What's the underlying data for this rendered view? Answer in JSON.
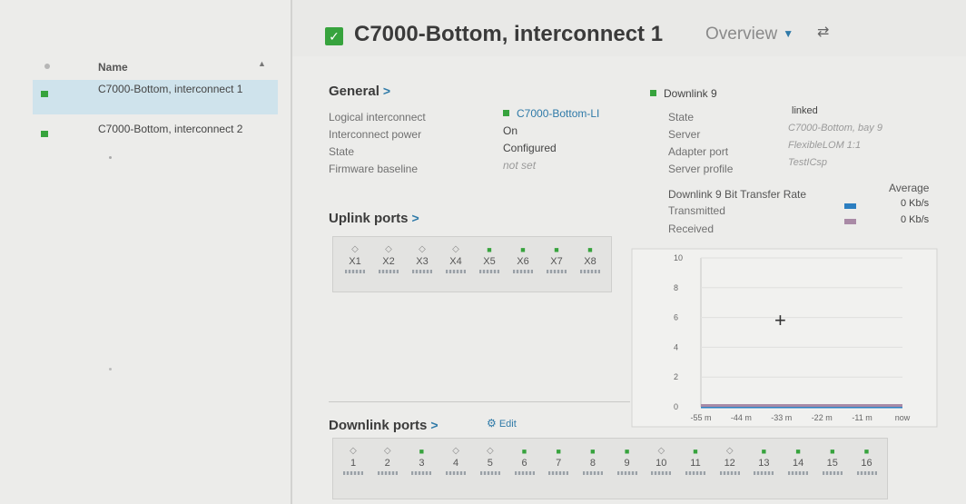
{
  "list": {
    "column_header": "Name",
    "items": [
      {
        "label": "C7000-Bottom, interconnect 1",
        "selected": true,
        "status_color": "#37a33d"
      },
      {
        "label": "C7000-Bottom, interconnect 2",
        "selected": false,
        "status_color": "#37a33d"
      }
    ]
  },
  "header": {
    "title": "C7000-Bottom, interconnect 1",
    "view_menu": "Overview",
    "status": "ok"
  },
  "general": {
    "title": "General",
    "rows": [
      {
        "label": "Logical interconnect",
        "value": "C7000-Bottom-LI",
        "kind": "link"
      },
      {
        "label": "Interconnect power",
        "value": "On",
        "kind": "plain"
      },
      {
        "label": "State",
        "value": "Configured",
        "kind": "plain"
      },
      {
        "label": "Firmware baseline",
        "value": "not set",
        "kind": "muted"
      }
    ]
  },
  "downlink_detail": {
    "title": "Downlink 9",
    "rows": [
      {
        "label": "State",
        "value": "linked",
        "kind": "plain"
      },
      {
        "label": "Server",
        "value": "C7000-Bottom, bay 9",
        "kind": "muted"
      },
      {
        "label": "Adapter port",
        "value": "FlexibleLOM 1:1",
        "kind": "muted"
      },
      {
        "label": "Server profile",
        "value": "TestICsp",
        "kind": "muted"
      }
    ],
    "rate_title": "Downlink 9 Bit Transfer Rate",
    "average_label": "Average",
    "transmitted_label": "Transmitted",
    "transmitted_value": "0 Kb/s",
    "received_label": "Received",
    "received_value": "0 Kb/s"
  },
  "uplink_ports": {
    "title": "Uplink ports",
    "ports": [
      {
        "label": "X1",
        "status": "unlinked"
      },
      {
        "label": "X2",
        "status": "unlinked"
      },
      {
        "label": "X3",
        "status": "unlinked"
      },
      {
        "label": "X4",
        "status": "unlinked"
      },
      {
        "label": "X5",
        "status": "linked"
      },
      {
        "label": "X6",
        "status": "linked"
      },
      {
        "label": "X7",
        "status": "linked"
      },
      {
        "label": "X8",
        "status": "linked"
      }
    ]
  },
  "downlink_ports": {
    "title": "Downlink ports",
    "edit_label": "Edit",
    "ports": [
      {
        "label": "1",
        "status": "unlinked"
      },
      {
        "label": "2",
        "status": "unlinked"
      },
      {
        "label": "3",
        "status": "linked"
      },
      {
        "label": "4",
        "status": "unlinked"
      },
      {
        "label": "5",
        "status": "unlinked"
      },
      {
        "label": "6",
        "status": "linked"
      },
      {
        "label": "7",
        "status": "linked"
      },
      {
        "label": "8",
        "status": "linked"
      },
      {
        "label": "9",
        "status": "linked"
      },
      {
        "label": "10",
        "status": "unlinked"
      },
      {
        "label": "11",
        "status": "linked"
      },
      {
        "label": "12",
        "status": "unlinked"
      },
      {
        "label": "13",
        "status": "linked"
      },
      {
        "label": "14",
        "status": "linked"
      },
      {
        "label": "15",
        "status": "linked"
      },
      {
        "label": "16",
        "status": "linked"
      }
    ]
  },
  "colors": {
    "linked": "#37a33d",
    "accent": "#2f7aa8",
    "transmitted": "#2b7ec0",
    "received": "#a98aa6",
    "selected_row": "#cfe3ec"
  },
  "chart_data": {
    "type": "line",
    "x": [
      "-55 m",
      "-44 m",
      "-33 m",
      "-22 m",
      "-11 m",
      "now"
    ],
    "y_ticks": [
      0,
      2,
      4,
      6,
      8,
      10
    ],
    "ylim": [
      0,
      10
    ],
    "series": [
      {
        "name": "Transmitted",
        "values": [
          0,
          0,
          0,
          0,
          0,
          0
        ]
      },
      {
        "name": "Received",
        "values": [
          0,
          0,
          0,
          0,
          0,
          0
        ]
      }
    ]
  }
}
